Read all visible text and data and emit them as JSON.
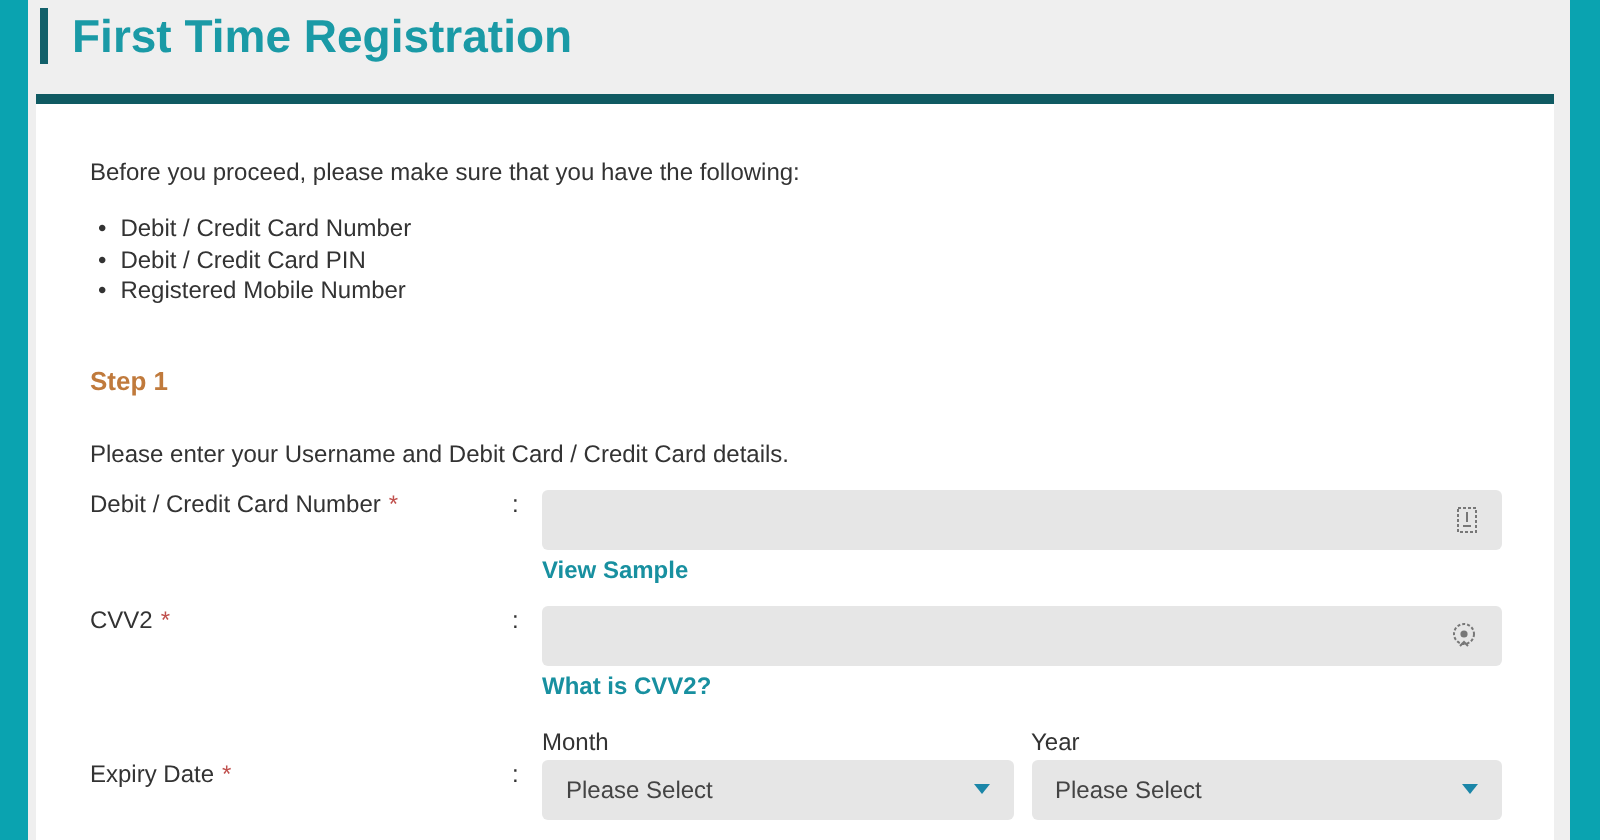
{
  "page_title": "First Time Registration",
  "intro": "Before you proceed, please make sure that you have the following:",
  "requirements": [
    {
      "bullet": "•",
      "text": "Debit / Credit Card Number"
    },
    {
      "bullet": "•",
      "text": "Debit / Credit Card PIN"
    },
    {
      "bullet": "•",
      "text": "Registered Mobile Number"
    }
  ],
  "step": "Step 1",
  "instruction": "Please enter your Username and Debit Card / Credit Card details.",
  "fields": [
    {
      "kind": "text",
      "label": "Debit / Credit Card Number",
      "required_mark": "*",
      "colon": ":",
      "link": "View Sample"
    },
    {
      "kind": "text",
      "label": "CVV2",
      "required_mark": "*",
      "colon": ":",
      "link": "What is CVV2?"
    },
    {
      "kind": "selects",
      "label": "Expiry Date",
      "required_mark": "*",
      "colon": ":",
      "selects": [
        {
          "caption": "Month",
          "value": "Please Select"
        },
        {
          "caption": "Year",
          "value": "Please Select"
        }
      ]
    }
  ]
}
